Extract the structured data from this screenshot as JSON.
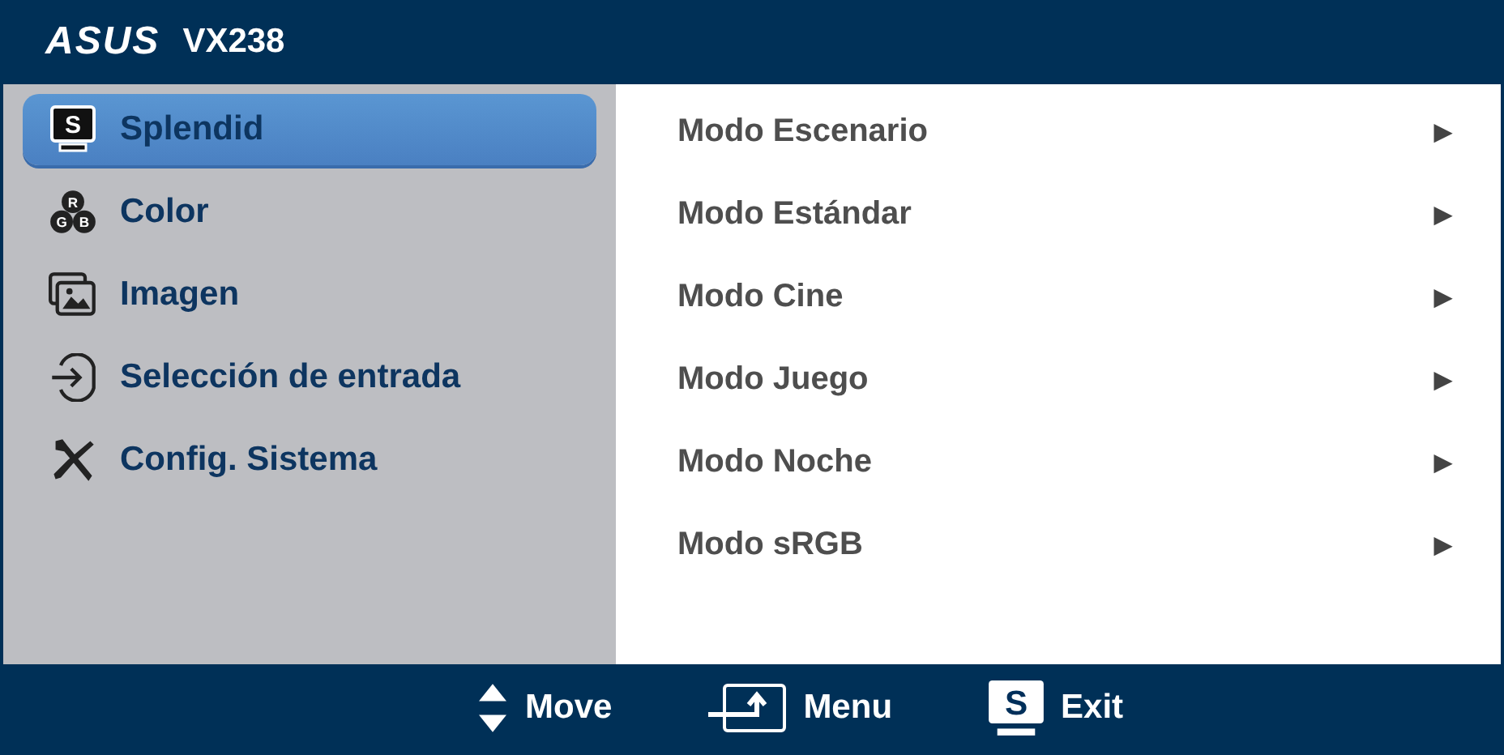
{
  "header": {
    "brand": "ASUS",
    "model": "VX238"
  },
  "sidebar": {
    "items": [
      {
        "label": "Splendid",
        "kind": "splendid",
        "icon_text": [
          "S"
        ],
        "selected": true
      },
      {
        "label": "Color",
        "kind": "rgb",
        "icon_text": [
          "R",
          "G",
          "B"
        ],
        "selected": false
      },
      {
        "label": "Imagen",
        "kind": "image",
        "selected": false
      },
      {
        "label": "Selección de entrada",
        "kind": "input",
        "selected": false
      },
      {
        "label": "Config. Sistema",
        "kind": "tools",
        "selected": false
      }
    ]
  },
  "options": [
    {
      "label": "Modo Escenario",
      "arrow": "▶"
    },
    {
      "label": "Modo Estándar",
      "arrow": "▶"
    },
    {
      "label": "Modo Cine",
      "arrow": "▶"
    },
    {
      "label": "Modo Juego",
      "arrow": "▶"
    },
    {
      "label": "Modo Noche",
      "arrow": "▶"
    },
    {
      "label": "Modo sRGB",
      "arrow": "▶"
    }
  ],
  "footer": [
    {
      "kind": "move",
      "label": "Move"
    },
    {
      "kind": "menu",
      "label": "Menu"
    },
    {
      "kind": "exit",
      "label": "Exit",
      "icon_text": "S"
    }
  ]
}
